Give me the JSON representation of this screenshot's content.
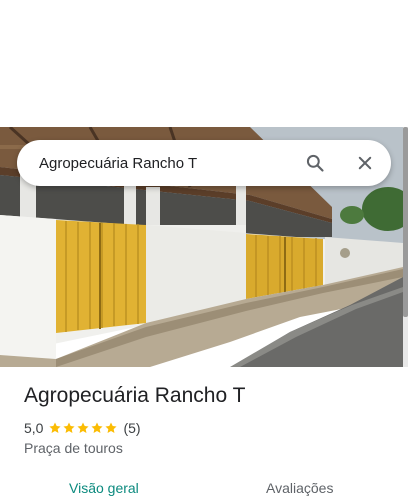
{
  "search": {
    "value": "Agropecuária Rancho T",
    "search_icon": "search-icon",
    "clear_icon": "close-icon"
  },
  "place": {
    "title": "Agropecuária Rancho T",
    "rating": "5,0",
    "stars": 5,
    "review_count": "(5)",
    "category": "Praça de touros"
  },
  "tabs": [
    {
      "label": "Visão geral",
      "active": true
    },
    {
      "label": "Avaliações",
      "active": false
    }
  ],
  "colors": {
    "accent": "#0b8a7e",
    "star": "#fbbc04",
    "text_primary": "#202124",
    "text_secondary": "#5f6368"
  }
}
